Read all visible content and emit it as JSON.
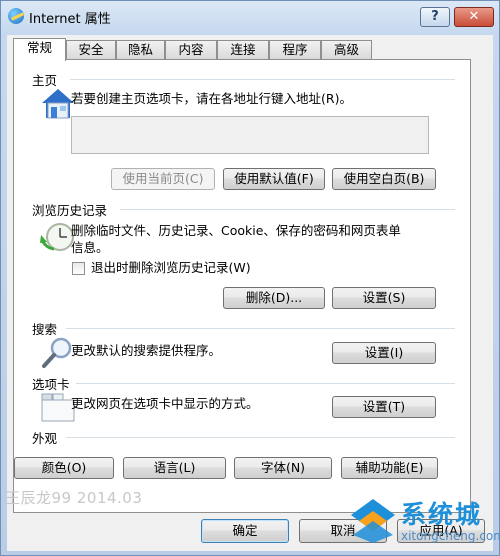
{
  "window": {
    "title": "Internet 属性",
    "help": "?",
    "close": "✕"
  },
  "tabs": [
    "常规",
    "安全",
    "隐私",
    "内容",
    "连接",
    "程序",
    "高级"
  ],
  "home": {
    "title": "主页",
    "desc": "若要创建主页选项卡，请在各地址行键入地址(R)。",
    "value": "",
    "buttons": {
      "current": "使用当前页(C)",
      "default": "使用默认值(F)",
      "blank": "使用空白页(B)"
    }
  },
  "history": {
    "title": "浏览历史记录",
    "desc_line1": "删除临时文件、历史记录、Cookie、保存的密码和网页表单",
    "desc_line2": "信息。",
    "checkbox_label": "退出时删除浏览历史记录(W)",
    "checkbox_checked": false,
    "buttons": {
      "delete": "删除(D)...",
      "settings": "设置(S)"
    }
  },
  "search": {
    "title": "搜索",
    "desc": "更改默认的搜索提供程序。",
    "button": "设置(I)"
  },
  "tabs_section": {
    "title": "选项卡",
    "desc": "更改网页在选项卡中显示的方式。",
    "button": "设置(T)"
  },
  "appearance": {
    "title": "外观",
    "buttons": [
      "颜色(O)",
      "语言(L)",
      "字体(N)",
      "辅助功能(E)"
    ]
  },
  "footer": {
    "ok": "确定",
    "cancel": "取消",
    "apply": "应用(A)"
  },
  "watermark": "王辰龙99 2014.03",
  "site_logo": {
    "brand": "系统城",
    "url": "xitongcheng.com"
  }
}
